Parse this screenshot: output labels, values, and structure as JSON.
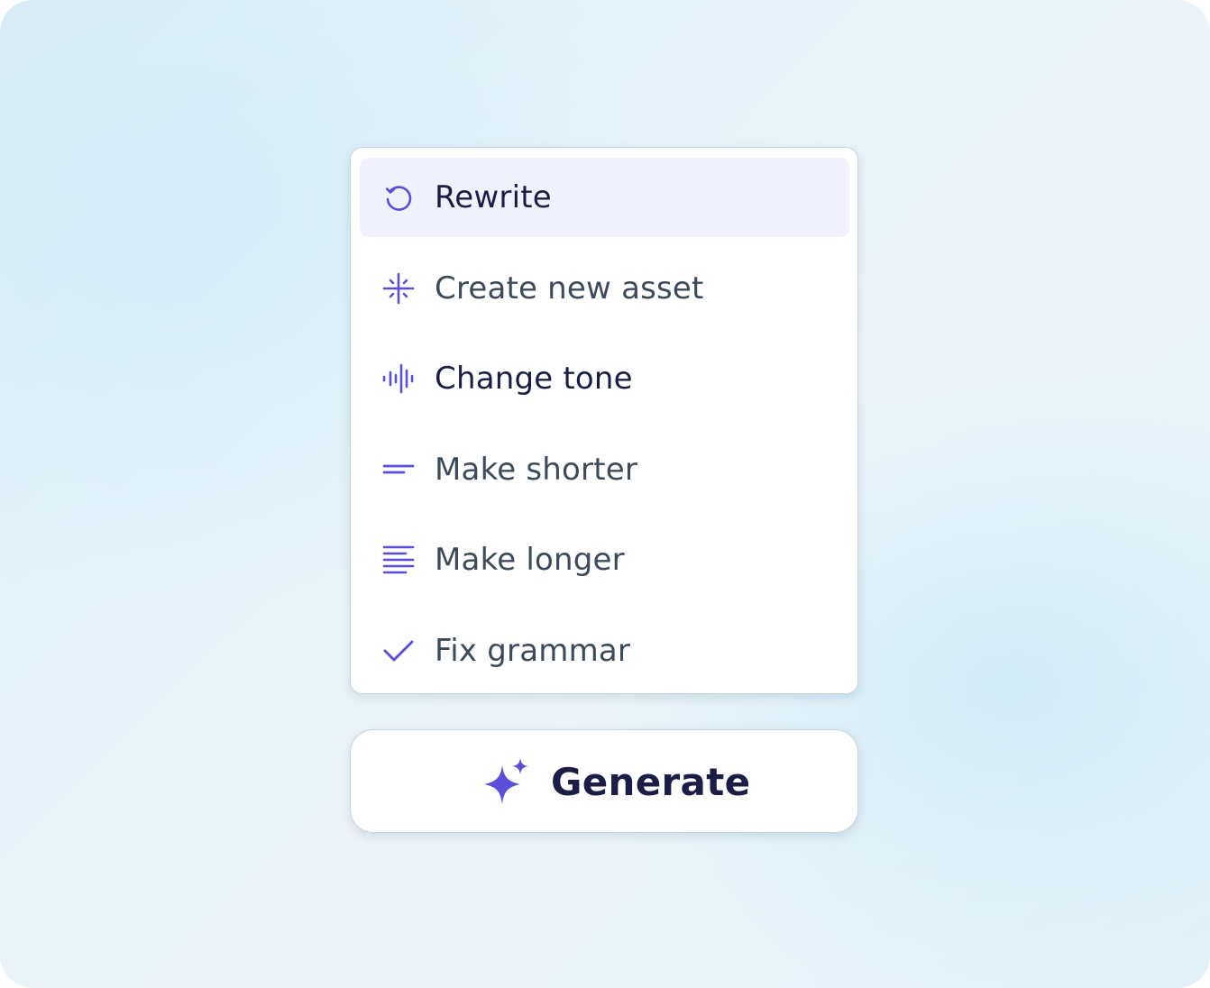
{
  "accent_color": "#5b4fd9",
  "menu": {
    "items": [
      {
        "label": "Rewrite",
        "icon": "rewrite-icon",
        "active": true
      },
      {
        "label": "Create new asset",
        "icon": "sparkle-burst-icon"
      },
      {
        "label": "Change tone",
        "icon": "audio-wave-icon"
      },
      {
        "label": "Make shorter",
        "icon": "short-lines-icon"
      },
      {
        "label": "Make longer",
        "icon": "long-lines-icon"
      },
      {
        "label": "Fix grammar",
        "icon": "checkmark-icon"
      }
    ]
  },
  "generate_button": {
    "label": "Generate",
    "icon": "sparkles-icon"
  }
}
